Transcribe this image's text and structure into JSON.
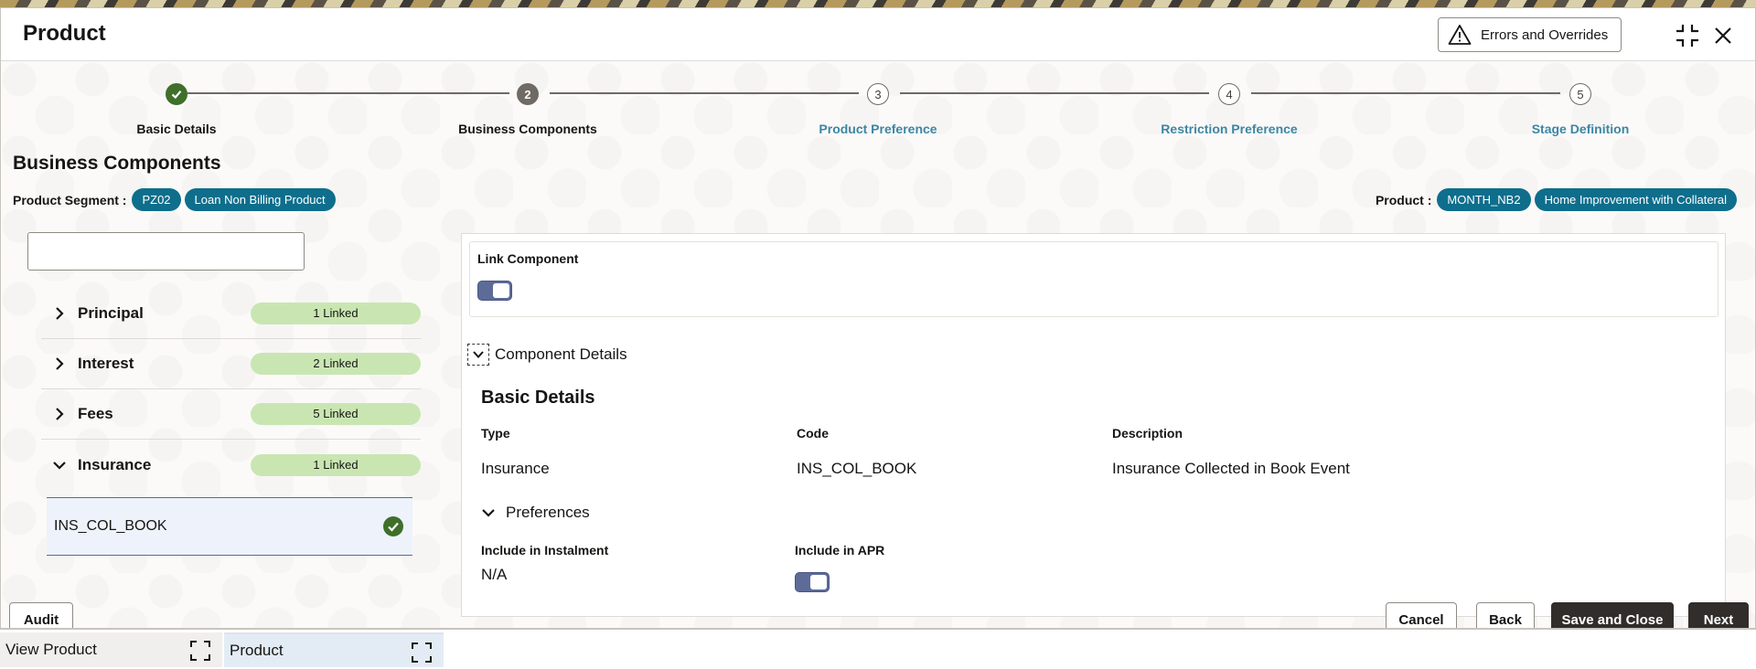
{
  "window": {
    "title": "Product",
    "errors_button": "Errors and Overrides"
  },
  "stepper": {
    "steps": [
      {
        "number": "1",
        "label": "Basic Details",
        "status": "done"
      },
      {
        "number": "2",
        "label": "Business Components",
        "status": "current"
      },
      {
        "number": "3",
        "label": "Product Preference",
        "status": "todo"
      },
      {
        "number": "4",
        "label": "Restriction Preference",
        "status": "todo"
      },
      {
        "number": "5",
        "label": "Stage Definition",
        "status": "todo"
      }
    ]
  },
  "section": {
    "title": "Business Components",
    "segment_label": "Product Segment :",
    "segment_code": "PZ02",
    "segment_name": "Loan Non Billing Product",
    "product_label": "Product :",
    "product_code": "MONTH_NB2",
    "product_name": "Home Improvement with Collateral"
  },
  "components": {
    "search_value": "",
    "items": [
      {
        "label": "Principal",
        "badge": "1 Linked",
        "expanded": false
      },
      {
        "label": "Interest",
        "badge": "2 Linked",
        "expanded": false
      },
      {
        "label": "Fees",
        "badge": "5 Linked",
        "expanded": false
      },
      {
        "label": "Insurance",
        "badge": "1 Linked",
        "expanded": true
      }
    ],
    "selected_sub_item": "INS_COL_BOOK"
  },
  "details": {
    "link_component_label": "Link Component",
    "link_component_on": true,
    "component_details_label": "Component Details",
    "basic_details_title": "Basic Details",
    "type_label": "Type",
    "type_value": "Insurance",
    "code_label": "Code",
    "code_value": "INS_COL_BOOK",
    "description_label": "Description",
    "description_value": "Insurance Collected in Book Event",
    "preferences_label": "Preferences",
    "include_instalment_label": "Include in Instalment",
    "include_instalment_value": "N/A",
    "include_apr_label": "Include in APR",
    "include_apr_on": true
  },
  "footer": {
    "audit": "Audit",
    "cancel": "Cancel",
    "back": "Back",
    "save_close": "Save and Close",
    "next": "Next"
  },
  "taskbar": {
    "tabs": [
      {
        "label": "View Product",
        "active": false
      },
      {
        "label": "Product",
        "active": true
      }
    ]
  },
  "colors": {
    "accent_teal": "#0e6e8c",
    "link_blue": "#3d86a3",
    "success_green": "#3f6f2a",
    "badge_green": "#c9e6b2",
    "dark_button": "#312d2a"
  }
}
